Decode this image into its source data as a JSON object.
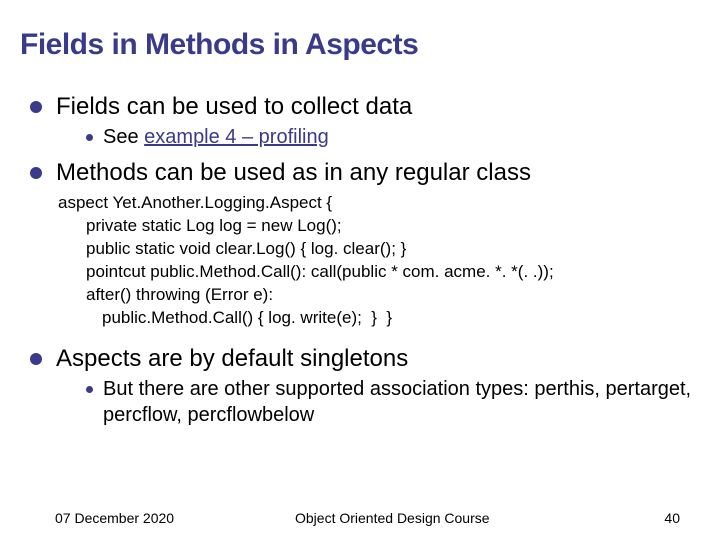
{
  "title": "Fields in Methods in Aspects",
  "bullets": {
    "b1": "Fields can be used to collect data",
    "b1_sub_prefix": "See ",
    "b1_sub_link": "example 4 – profiling",
    "b2": "Methods can be used as in any regular class",
    "b3": "Aspects are by default singletons",
    "b3_sub": "But there are other supported association types: perthis, pertarget, percflow, percflowbelow"
  },
  "code": {
    "l1": "aspect Yet.Another.Logging.Aspect {",
    "l2": "private static Log log = new Log();",
    "l3": "public static void clear.Log() { log. clear(); }",
    "l4": "pointcut public.Method.Call(): call(public * com. acme. *. *(. .));",
    "l5": "after() throwing (Error e):",
    "l6": "public.Method.Call() { log. write(e);  }  }"
  },
  "footer": {
    "date": "07 December 2020",
    "course": "Object Oriented Design Course",
    "page": "40"
  }
}
